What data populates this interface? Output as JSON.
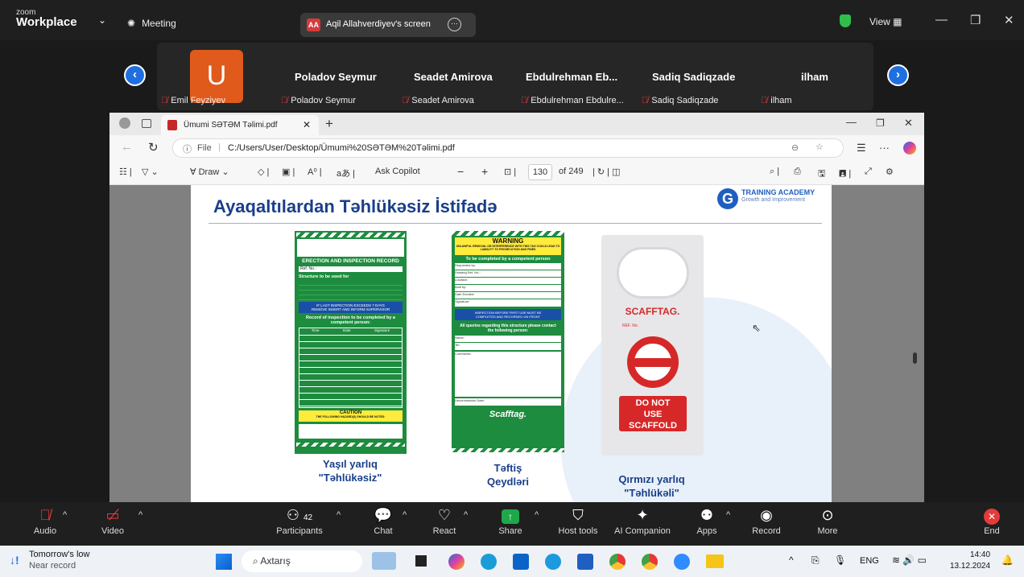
{
  "zoom": {
    "brand_top": "zoom",
    "brand": "Workplace",
    "meeting": "Meeting",
    "share_initials": "AA",
    "share_label": "Aqil Allahverdiyev's screen",
    "view": "View"
  },
  "gallery": {
    "avatar_letter": "U",
    "names": [
      "Poladov Seymur",
      "Seadet Amirova",
      "Ebdulrehman  Eb...",
      "Sadiq Sadiqzade",
      "ilham"
    ],
    "labels": [
      "Emil Feyziyev",
      "Poladov Seymur",
      "Seadet Amirova",
      "Ebdulrehman Ebdulre...",
      "Sadiq Sadiqzade",
      "ilham"
    ]
  },
  "browser": {
    "tab_title": "Ümumi SƏTƏM Təlimi.pdf",
    "url_prefix": "File",
    "url": "C:/Users/User/Desktop/Ümumi%20SƏTƏM%20Təlimi.pdf",
    "draw": "Draw",
    "ask_copilot": "Ask Copilot",
    "page_num": "130",
    "page_of": "of 249"
  },
  "slide": {
    "title": "Ayaqaltılardan Təhlükəsiz İstifadə",
    "brand": "TRAINING ACADEMY",
    "brand_sub": "Growth and Improvement",
    "tag1": {
      "header": "ERECTION AND INSPECTION RECORD",
      "ref": "Ref. No.:",
      "struct": "Structure to be used for",
      "notice": "IF LAST INSPECTION EXCEEDS 7 DAYS REMOVE INSERT AND INFORM SUPERVISOR",
      "record": "Record of inspection to be completed by a competent person:",
      "cols": [
        "Time",
        "Date",
        "Signature"
      ],
      "caution": "CAUTION",
      "caution_sub": "THE FOLLOWING HAZARD(S) SHOULD BE NOTED:",
      "caption1": "Yaşıl yarlıq",
      "caption2": "\"Təhlükəsiz\""
    },
    "tag2": {
      "warning": "WARNING",
      "warning_sub": "UNLAWFUL REMOVAL OR INTERFERENCE WITH THIS TAG COULD LEAD TO LIABILITY TO PROSECUTION AND FINES",
      "completed": "To be completed by a competent person",
      "fields": [
        "Requested by:",
        "Drawing Ref. No.:",
        "Location:",
        "Built by:",
        "Date Erected:",
        "Signature:"
      ],
      "notice": "INSPECTION BEFORE FIRST USE MUST BE COMPLETED AND RECORDED ON FRONT",
      "queries": "All queries regarding this structure please contact the following person:",
      "name": "Name:",
      "tel": "Tel.:",
      "comments": "Comments:",
      "decom": "Decommission Date:",
      "brand": "Scafftag.",
      "caption1": "Təftiş",
      "caption2": "Qeydləri"
    },
    "tag3": {
      "brand": "SCAFFTAG.",
      "ref": "REF. No.",
      "dont1": "DO NOT",
      "dont2": "USE",
      "dont3": "SCAFFOLD",
      "caption1": "Qırmızı yarlıq",
      "caption2": "\"Təhlükəli\""
    }
  },
  "controls": {
    "audio": "Audio",
    "video": "Video",
    "participants": "Participants",
    "participants_count": "42",
    "chat": "Chat",
    "react": "React",
    "share": "Share",
    "host_tools": "Host tools",
    "ai": "AI Companion",
    "apps": "Apps",
    "record": "Record",
    "more": "More",
    "end": "End"
  },
  "taskbar": {
    "weather1": "Tomorrow's low",
    "weather2": "Near record",
    "search": "Axtarış",
    "lang": "ENG",
    "time": "14:40",
    "date": "13.12.2024"
  },
  "colors": {
    "tag_green": "#1e8c3f",
    "accent_blue": "#1f6fe0",
    "stop_red": "#d62828",
    "slide_title": "#1a3f8a"
  }
}
